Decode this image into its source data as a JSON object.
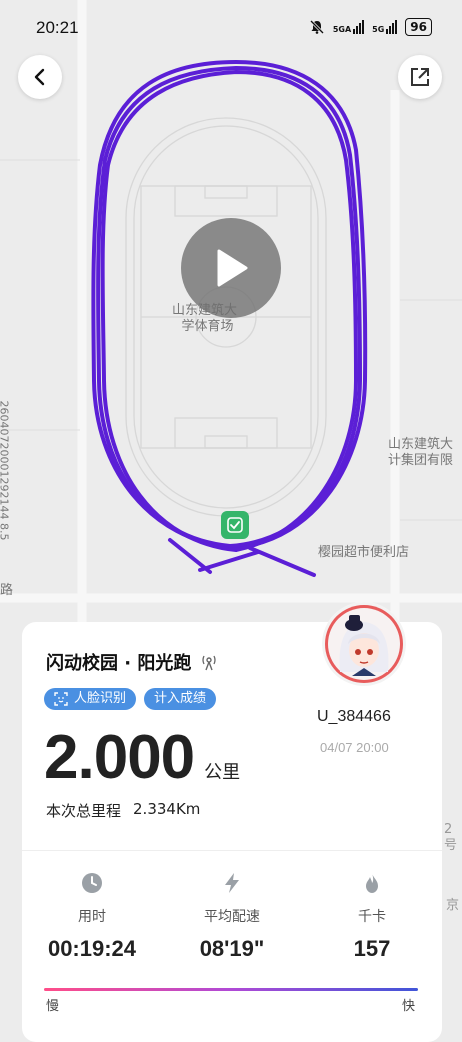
{
  "status": {
    "time": "20:21",
    "net1": "5GA",
    "net2": "5G",
    "battery": "96"
  },
  "map": {
    "venue_label_line1": "山东建筑大",
    "venue_label_line2": "学体育场",
    "right_label_line1": "山东建筑大",
    "right_label_line2": "计集团有限",
    "store_label": "樱园超市便利店",
    "road_fragment": "路",
    "vertical_id": "26040720001292144 8.5",
    "edge_fragment_1": "2号",
    "edge_fragment_2": "京"
  },
  "summary": {
    "title": "闪动校园 · 阳光跑",
    "tags": [
      "人脸识别",
      "计入成绩"
    ],
    "distance_value": "2.000",
    "distance_unit": "公里",
    "total_label": "本次总里程",
    "total_value": "2.334Km",
    "username": "U_384466",
    "datetime": "04/07 20:00"
  },
  "stats": [
    {
      "label": "用时",
      "value": "00:19:24",
      "icon": "clock-icon"
    },
    {
      "label": "平均配速",
      "value": "08'19\"",
      "icon": "lightning-icon"
    },
    {
      "label": "千卡",
      "value": "157",
      "icon": "flame-icon"
    }
  ],
  "pace_legend": {
    "slow": "慢",
    "fast": "快"
  },
  "colors": {
    "route": "#5b1fd6",
    "tag": "#4a90e2",
    "marker": "#35b56a"
  }
}
